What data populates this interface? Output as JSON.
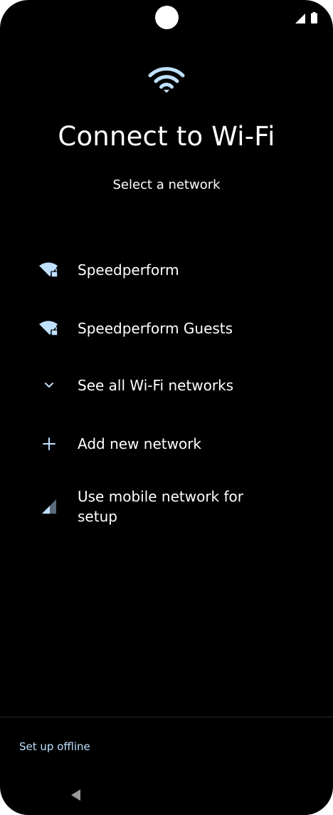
{
  "screen": {
    "title": "Connect to Wi-Fi",
    "subtitle": "Select a network"
  },
  "networks": [
    {
      "label": "Speedperform",
      "icon": "wifi-lock-icon"
    },
    {
      "label": "Speedperform Guests",
      "icon": "wifi-lock-icon"
    },
    {
      "label": "See all Wi-Fi networks",
      "icon": "chevron-down-icon"
    },
    {
      "label": "Add new network",
      "icon": "plus-icon"
    },
    {
      "label": "Use mobile network for setup",
      "icon": "cellular-signal-icon"
    }
  ],
  "footer": {
    "offline_label": "Set up offline"
  },
  "colors": {
    "background": "#000000",
    "accent": "#bfe0ff",
    "text": "#ffffff"
  }
}
